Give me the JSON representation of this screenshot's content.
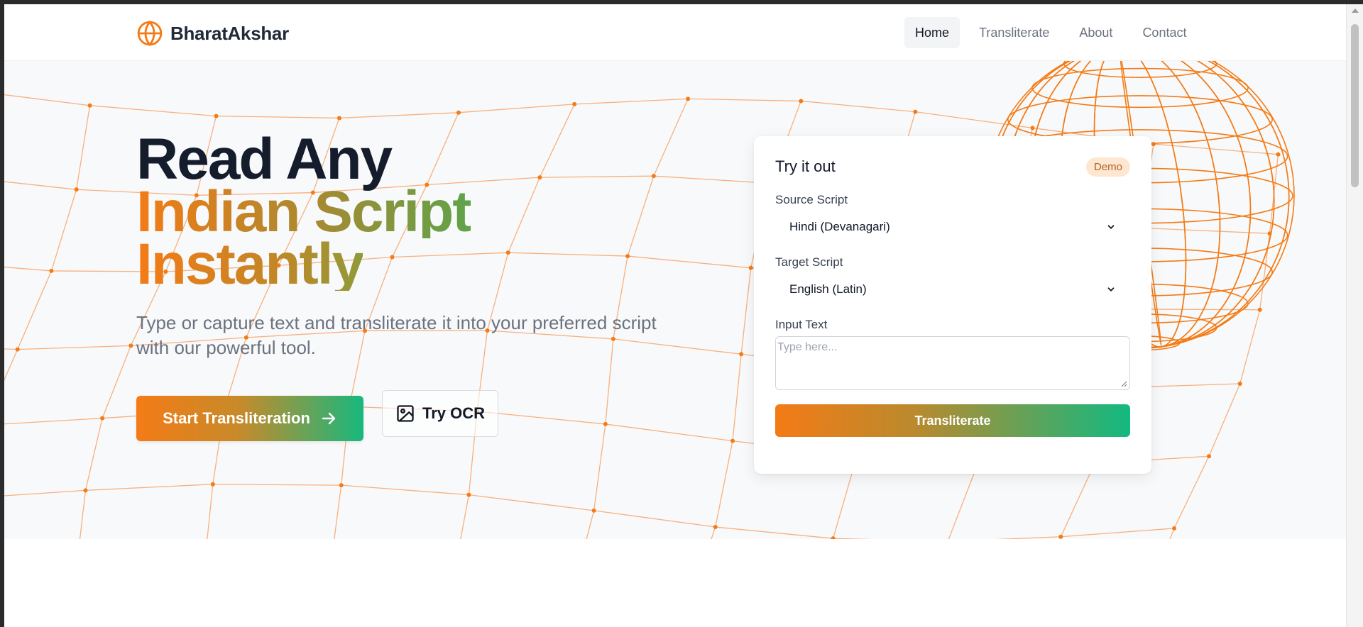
{
  "brand": {
    "name": "BharatAkshar",
    "logo_icon": "globe-icon",
    "accent": "#f47b16",
    "accent_secondary": "#10b981"
  },
  "nav": {
    "items": [
      {
        "label": "Home",
        "active": true
      },
      {
        "label": "Transliterate",
        "active": false
      },
      {
        "label": "About",
        "active": false
      },
      {
        "label": "Contact",
        "active": false
      }
    ]
  },
  "hero": {
    "headline_line1": "Read Any",
    "headline_line2": "Indian Script",
    "headline_line3": "Instantly",
    "subtitle": "Type or capture text and transliterate it into your preferred script with our powerful tool.",
    "primary_button": "Start Transliteration",
    "primary_button_icon": "arrow-right-icon",
    "secondary_button": "Try OCR",
    "secondary_button_icon": "image-icon"
  },
  "demo_card": {
    "title": "Try it out",
    "badge": "Demo",
    "source_label": "Source Script",
    "source_value": "Hindi (Devanagari)",
    "target_label": "Target Script",
    "target_value": "English (Latin)",
    "input_label": "Input Text",
    "input_placeholder": "Type here...",
    "submit_label": "Transliterate"
  }
}
